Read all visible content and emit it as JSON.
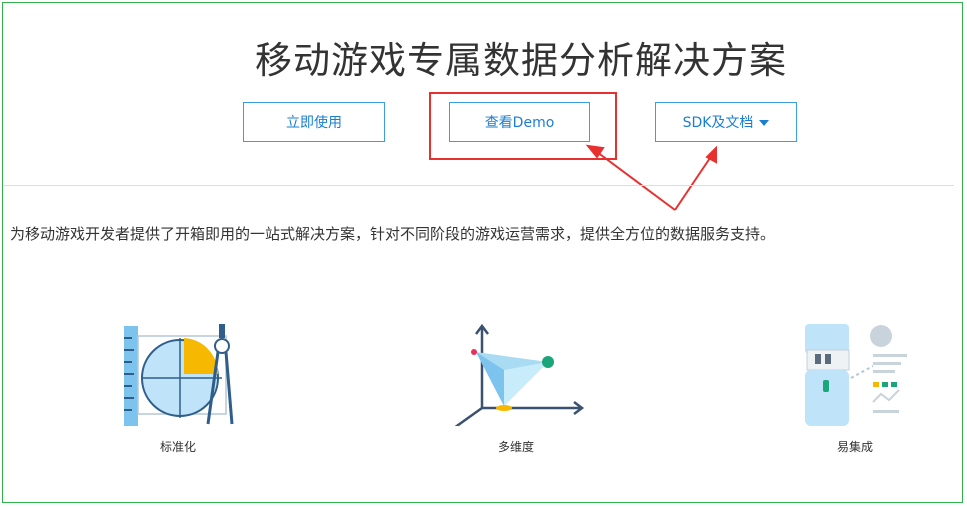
{
  "header": {
    "title": "移动游戏专属数据分析解决方案"
  },
  "actions": {
    "use_label": "立即使用",
    "demo_label": "查看Demo",
    "sdk_label": "SDK及文档"
  },
  "description": "为移动游戏开发者提供了开箱即用的一站式解决方案，针对不同阶段的游戏运营需求，提供全方位的数据服务支持。",
  "features": [
    {
      "label": "标准化",
      "icon": "ruler-compass-icon"
    },
    {
      "label": "多维度",
      "icon": "3d-axis-icon"
    },
    {
      "label": "易集成",
      "icon": "usb-integration-icon"
    }
  ],
  "colors": {
    "accent": "#1a7fd1",
    "button_border": "#3a9ee0",
    "highlight": "#e8312f",
    "frame": "#2fb34a"
  }
}
